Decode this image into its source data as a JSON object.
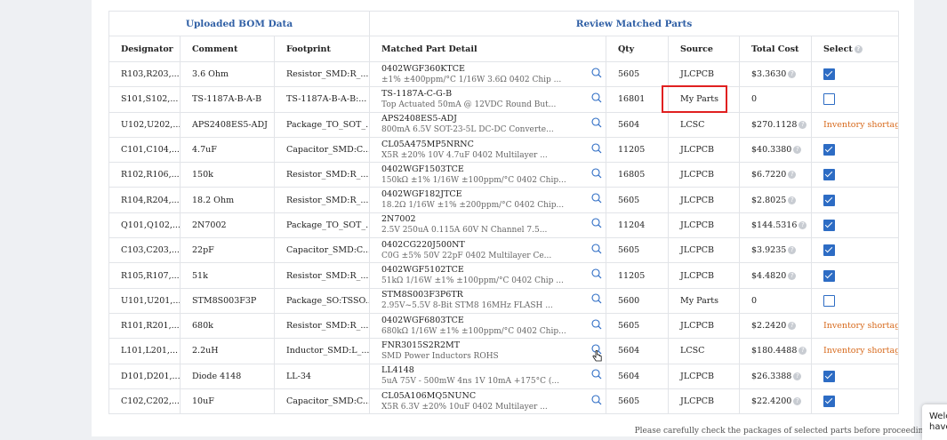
{
  "groups": {
    "uploaded": "Uploaded BOM Data",
    "review": "Review Matched Parts"
  },
  "columns": [
    "Designator",
    "Comment",
    "Footprint",
    "Matched Part Detail",
    "Qty",
    "Source",
    "Total Cost",
    "Select"
  ],
  "rows": [
    {
      "designator": "R103,R203,...",
      "comment": "3.6 Ohm",
      "footprint": "Resistor_SMD:R_...",
      "part": "0402WGF360KTCE",
      "desc": "±1% ±400ppm/°C 1/16W 3.6Ω 0402 Chip ...",
      "qty": "5605",
      "source": "JLCPCB",
      "cost": "$3.3630",
      "help": true,
      "select": "checked"
    },
    {
      "designator": "S101,S102,...",
      "comment": "TS-1187A-B-A-B",
      "footprint": "TS-1187A-B-A-B:...",
      "part": "TS-1187A-C-G-B",
      "desc": "Top Actuated 50mA @ 12VDC Round But...",
      "qty": "16801",
      "source": "My Parts",
      "cost": "0",
      "help": false,
      "select": "unchecked"
    },
    {
      "designator": "U102,U202,...",
      "comment": "APS2408ES5-ADJ",
      "footprint": "Package_TO_SOT_...",
      "part": "APS2408ES5-ADJ",
      "desc": "800mA 6.5V SOT-23-5L DC-DC Converte...",
      "qty": "5604",
      "source": "LCSC",
      "cost": "$270.1128",
      "help": true,
      "select": "Inventory shortage"
    },
    {
      "designator": "C101,C104,...",
      "comment": "4.7uF",
      "footprint": "Capacitor_SMD:C...",
      "part": "CL05A475MP5NRNC",
      "desc": "X5R ±20% 10V 4.7uF 0402 Multilayer ...",
      "qty": "11205",
      "source": "JLCPCB",
      "cost": "$40.3380",
      "help": true,
      "select": "checked"
    },
    {
      "designator": "R102,R106,...",
      "comment": "150k",
      "footprint": "Resistor_SMD:R_...",
      "part": "0402WGF1503TCE",
      "desc": "150kΩ ±1% 1/16W ±100ppm/°C 0402 Chip...",
      "qty": "16805",
      "source": "JLCPCB",
      "cost": "$6.7220",
      "help": true,
      "select": "checked"
    },
    {
      "designator": "R104,R204,...",
      "comment": "18.2 Ohm",
      "footprint": "Resistor_SMD:R_...",
      "part": "0402WGF182JTCE",
      "desc": "18.2Ω 1/16W ±1% ±200ppm/°C 0402 Chip...",
      "qty": "5605",
      "source": "JLCPCB",
      "cost": "$2.8025",
      "help": true,
      "select": "checked"
    },
    {
      "designator": "Q101,Q102,...",
      "comment": "2N7002",
      "footprint": "Package_TO_SOT_...",
      "part": "2N7002",
      "desc": "2.5V 250uA 0.115A 60V N Channel 7.5...",
      "qty": "11204",
      "source": "JLCPCB",
      "cost": "$144.5316",
      "help": true,
      "select": "checked"
    },
    {
      "designator": "C103,C203,...",
      "comment": "22pF",
      "footprint": "Capacitor_SMD:C...",
      "part": "0402CG220J500NT",
      "desc": "C0G ±5% 50V 22pF 0402 Multilayer Ce...",
      "qty": "5605",
      "source": "JLCPCB",
      "cost": "$3.9235",
      "help": true,
      "select": "checked"
    },
    {
      "designator": "R105,R107,...",
      "comment": "51k",
      "footprint": "Resistor_SMD:R_...",
      "part": "0402WGF5102TCE",
      "desc": "51kΩ 1/16W ±1% ±100ppm/°C 0402 Chip ...",
      "qty": "11205",
      "source": "JLCPCB",
      "cost": "$4.4820",
      "help": true,
      "select": "checked"
    },
    {
      "designator": "U101,U201,...",
      "comment": "STM8S003F3P",
      "footprint": "Package_SO:TSSO...",
      "part": "STM8S003F3P6TR",
      "desc": "2.95V~5.5V 8-Bit STM8 16MHz FLASH ...",
      "qty": "5600",
      "source": "My Parts",
      "cost": "0",
      "help": false,
      "select": "unchecked"
    },
    {
      "designator": "R101,R201,...",
      "comment": "680k",
      "footprint": "Resistor_SMD:R_...",
      "part": "0402WGF6803TCE",
      "desc": "680kΩ 1/16W ±1% ±100ppm/°C 0402 Chip...",
      "qty": "5605",
      "source": "JLCPCB",
      "cost": "$2.2420",
      "help": true,
      "select": "Inventory shortage"
    },
    {
      "designator": "L101,L201,...",
      "comment": "2.2uH",
      "footprint": "Inductor_SMD:L_...",
      "part": "FNR3015S2R2MT",
      "desc": "SMD Power Inductors ROHS",
      "qty": "5604",
      "source": "LCSC",
      "cost": "$180.4488",
      "help": true,
      "select": "Inventory shortage"
    },
    {
      "designator": "D101,D201,...",
      "comment": "Diode 4148",
      "footprint": "LL-34",
      "part": "LL4148",
      "desc": "5uA 75V - 500mW 4ns 1V 10mA +175°C (...",
      "qty": "5604",
      "source": "JLCPCB",
      "cost": "$26.3388",
      "help": true,
      "select": "checked"
    },
    {
      "designator": "C102,C202,...",
      "comment": "10uF",
      "footprint": "Capacitor_SMD:C...",
      "part": "CL05A106MQ5NUNC",
      "desc": "X5R 6.3V ±20% 10uF 0402 Multilayer ...",
      "qty": "5605",
      "source": "JLCPCB",
      "cost": "$22.4200",
      "help": true,
      "select": "checked"
    }
  ],
  "footer_note": "Please carefully check the packages of selected parts before proceeding.",
  "toast": {
    "line1": "Welc",
    "line2": "have"
  },
  "colors": {
    "accent": "#2d6cc4",
    "warning": "#d76a1d",
    "highlight": "#e02020"
  },
  "icons": {
    "search": "search-icon",
    "help": "help-icon",
    "cursor": "hand-cursor-icon"
  }
}
